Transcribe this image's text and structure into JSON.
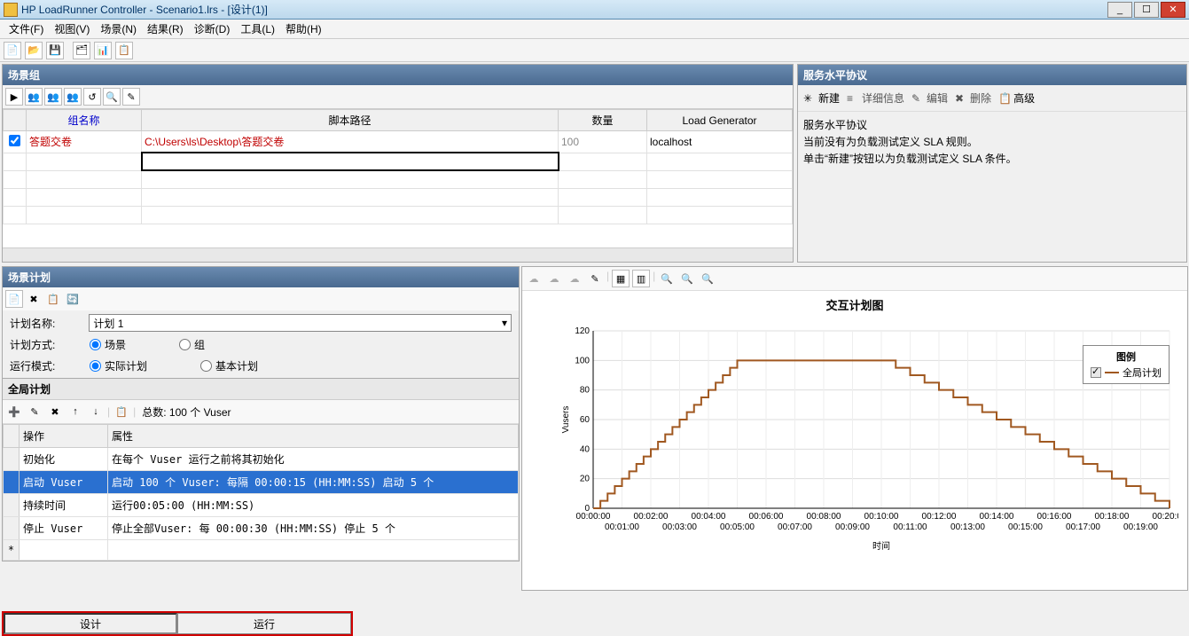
{
  "window": {
    "title": "HP LoadRunner Controller - Scenario1.lrs - [设计(1)]"
  },
  "menu": {
    "file": "文件(F)",
    "view": "视图(V)",
    "scenario": "场景(N)",
    "results": "结果(R)",
    "diag": "诊断(D)",
    "tools": "工具(L)",
    "help": "帮助(H)"
  },
  "scenario_group": {
    "title": "场景组",
    "cols": {
      "group": "组名称",
      "path": "脚本路径",
      "qty": "数量",
      "lg": "Load Generator"
    },
    "row": {
      "name": "答题交卷",
      "path": "C:\\Users\\ls\\Desktop\\答题交卷",
      "qty": "100",
      "lg": "localhost"
    }
  },
  "sla": {
    "title": "服务水平协议",
    "btns": {
      "new": "新建",
      "detail": "详细信息",
      "edit": "编辑",
      "del": "删除",
      "adv": "高级"
    },
    "h": "服务水平协议",
    "l1": "当前没有为负载测试定义 SLA 规则。",
    "l2": "单击“新建”按钮以为负载测试定义 SLA 条件。"
  },
  "schedule": {
    "title": "场景计划",
    "plan_name_label": "计划名称:",
    "plan_name": "计划 1",
    "method_label": "计划方式:",
    "method_scene": "场景",
    "method_group": "组",
    "mode_label": "运行模式:",
    "mode_real": "实际计划",
    "mode_basic": "基本计划"
  },
  "global": {
    "title": "全局计划",
    "total": "总数: 100 个 Vuser",
    "cols": {
      "op": "操作",
      "attr": "属性"
    },
    "rows": [
      {
        "op": "初始化",
        "attr": "在每个 Vuser 运行之前将其初始化"
      },
      {
        "op": "启动 Vuser",
        "attr": "启动 100 个 Vuser: 每隔 00:00:15 (HH:MM:SS) 启动 5 个"
      },
      {
        "op": "持续时间",
        "attr": "运行00:05:00 (HH:MM:SS)"
      },
      {
        "op": "停止 Vuser",
        "attr": "停止全部Vuser: 每 00:00:30 (HH:MM:SS) 停止 5 个"
      }
    ]
  },
  "chart": {
    "title": "交互计划图",
    "ylabel": "Vusers",
    "xlabel": "时间",
    "legend_title": "图例",
    "legend_series": "全局计划"
  },
  "tabs": {
    "design": "设计",
    "run": "运行"
  },
  "chart_data": {
    "type": "line",
    "title": "交互计划图",
    "xlabel": "时间",
    "ylabel": "Vusers",
    "ylim": [
      0,
      120
    ],
    "xlim_sec": [
      0,
      1200
    ],
    "x_tick_labels": [
      "00:00:00",
      "00:01:00",
      "00:02:00",
      "00:03:00",
      "00:04:00",
      "00:05:00",
      "00:06:00",
      "00:07:00",
      "00:08:00",
      "00:09:00",
      "00:10:00",
      "00:11:00",
      "00:12:00",
      "00:13:00",
      "00:14:00",
      "00:15:00",
      "00:16:00",
      "00:17:00",
      "00:18:00",
      "00:19:00",
      "00:20:00"
    ],
    "series": [
      {
        "name": "全局计划",
        "color": "#a05820",
        "x_sec": [
          0,
          15,
          30,
          45,
          60,
          75,
          90,
          105,
          120,
          135,
          150,
          165,
          180,
          195,
          210,
          225,
          240,
          255,
          270,
          285,
          300,
          600,
          630,
          660,
          690,
          720,
          750,
          780,
          810,
          840,
          870,
          900,
          930,
          960,
          990,
          1020,
          1050,
          1080,
          1110,
          1140,
          1170,
          1200
        ],
        "y": [
          0,
          5,
          10,
          15,
          20,
          25,
          30,
          35,
          40,
          45,
          50,
          55,
          60,
          65,
          70,
          75,
          80,
          85,
          90,
          95,
          100,
          100,
          95,
          90,
          85,
          80,
          75,
          70,
          65,
          60,
          55,
          50,
          45,
          40,
          35,
          30,
          25,
          20,
          15,
          10,
          5,
          0
        ]
      }
    ]
  }
}
